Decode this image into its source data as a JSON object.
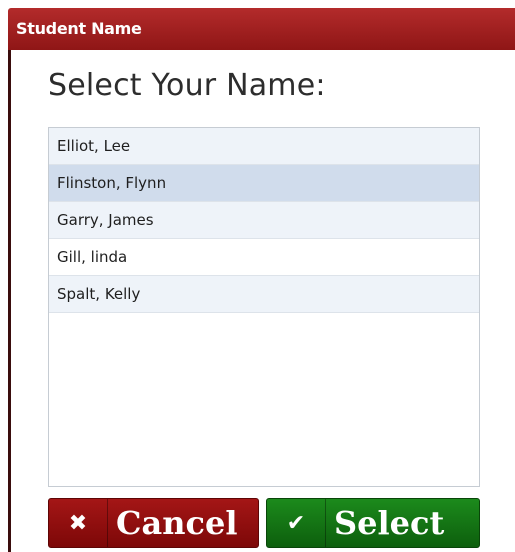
{
  "dialog": {
    "title": "Student Name",
    "heading": "Select Your Name:"
  },
  "list": {
    "items": [
      {
        "label": "Elliot, Lee",
        "selected": false
      },
      {
        "label": "Flinston, Flynn",
        "selected": true
      },
      {
        "label": "Garry, James",
        "selected": false
      },
      {
        "label": "Gill, linda",
        "selected": false
      },
      {
        "label": "Spalt, Kelly",
        "selected": false
      }
    ]
  },
  "buttons": {
    "cancel": {
      "label": "Cancel",
      "icon": "x-icon",
      "color": "#8f1010"
    },
    "select": {
      "label": "Select",
      "icon": "check-icon",
      "color": "#147514"
    }
  },
  "colors": {
    "titlebar": "#a12020",
    "selected_row": "#d0dcec"
  }
}
